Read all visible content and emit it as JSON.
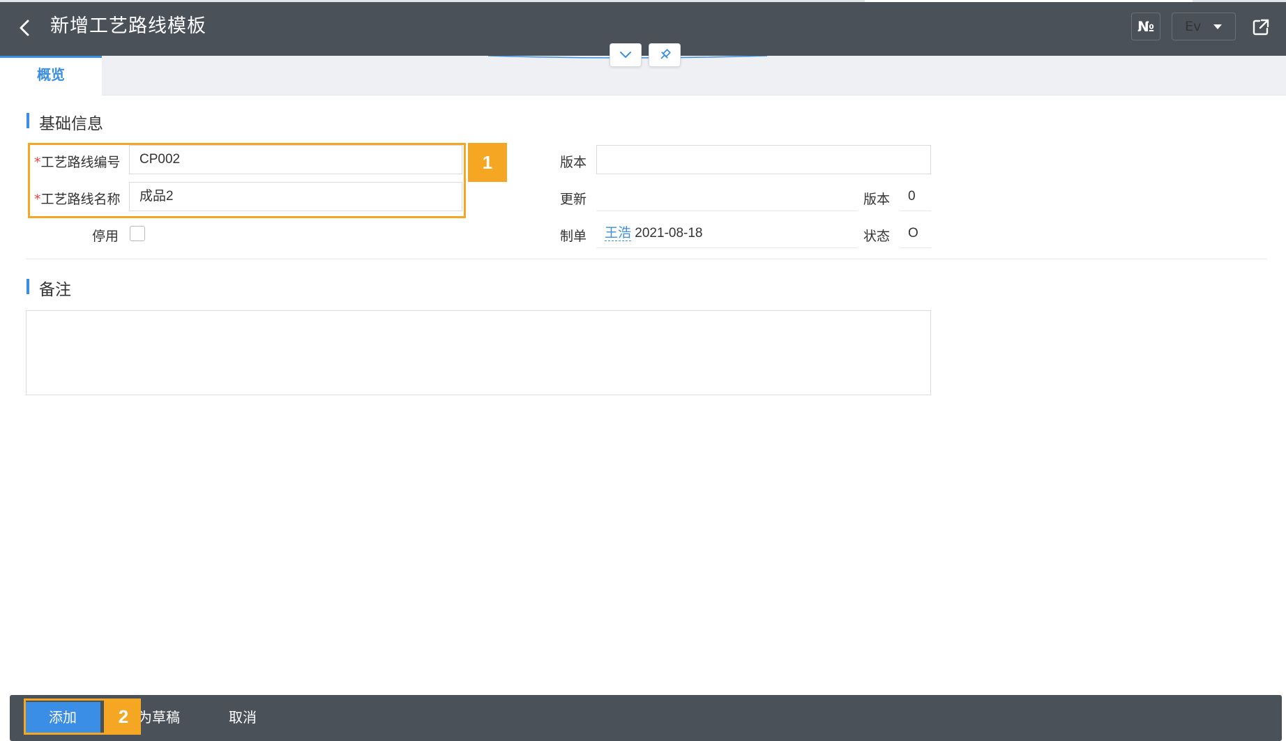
{
  "header": {
    "title": "新增工艺路线模板",
    "number_button": "№",
    "env_button": "Ev"
  },
  "tabs": [
    {
      "label": "概览",
      "active": true
    }
  ],
  "basic_info": {
    "section_title": "基础信息",
    "route_code": {
      "required_mark": "*",
      "label": "工艺路线编号",
      "value": "CP002"
    },
    "route_name": {
      "required_mark": "*",
      "label": "工艺路线名称",
      "value": "成品2"
    },
    "disabled": {
      "label": "停用",
      "checked": false
    },
    "version_input": {
      "label": "版本",
      "value": ""
    },
    "update": {
      "label": "更新",
      "value": ""
    },
    "version_number": {
      "label": "版本",
      "value": "0"
    },
    "created": {
      "label": "制单",
      "user": "王浩",
      "date": "2021-08-18"
    },
    "status": {
      "label": "状态",
      "value": "O"
    }
  },
  "remarks": {
    "section_title": "备注",
    "value": ""
  },
  "annotations": {
    "badge_1": "1",
    "badge_2": "2",
    "highlight_color": "#f5a623"
  },
  "footer": {
    "add_label": "添加",
    "save_draft_label": "为草稿",
    "cancel_label": "取消"
  },
  "colors": {
    "header_bg": "#4b5159",
    "accent": "#3a8ee6",
    "required": "#e04848"
  }
}
